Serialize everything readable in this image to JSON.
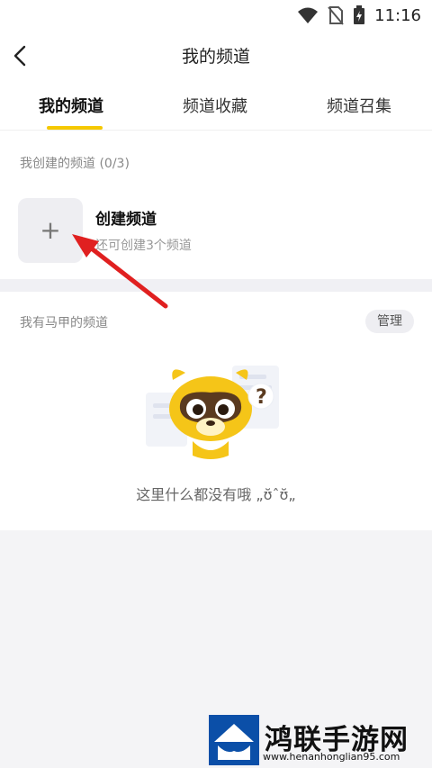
{
  "status_bar": {
    "time": "11:16"
  },
  "header": {
    "title": "我的频道"
  },
  "tabs": [
    {
      "label": "我的频道",
      "active": true
    },
    {
      "label": "频道收藏",
      "active": false
    },
    {
      "label": "频道召集",
      "active": false
    }
  ],
  "created_section": {
    "label": "我创建的频道 (0/3)",
    "create_title": "创建频道",
    "create_subtitle": "还可创建3个频道"
  },
  "alias_section": {
    "label": "我有马甲的频道",
    "manage_label": "管理",
    "empty_text": "这里什么都没有哦 „ʊ̆ˆʊ̆„"
  },
  "watermark": {
    "name": "鸿联手游网",
    "url": "www.henanhonglian95.com"
  },
  "colors": {
    "accent": "#f5c800",
    "annotation_arrow": "#e02020",
    "watermark_blue": "#0b4fa8"
  }
}
